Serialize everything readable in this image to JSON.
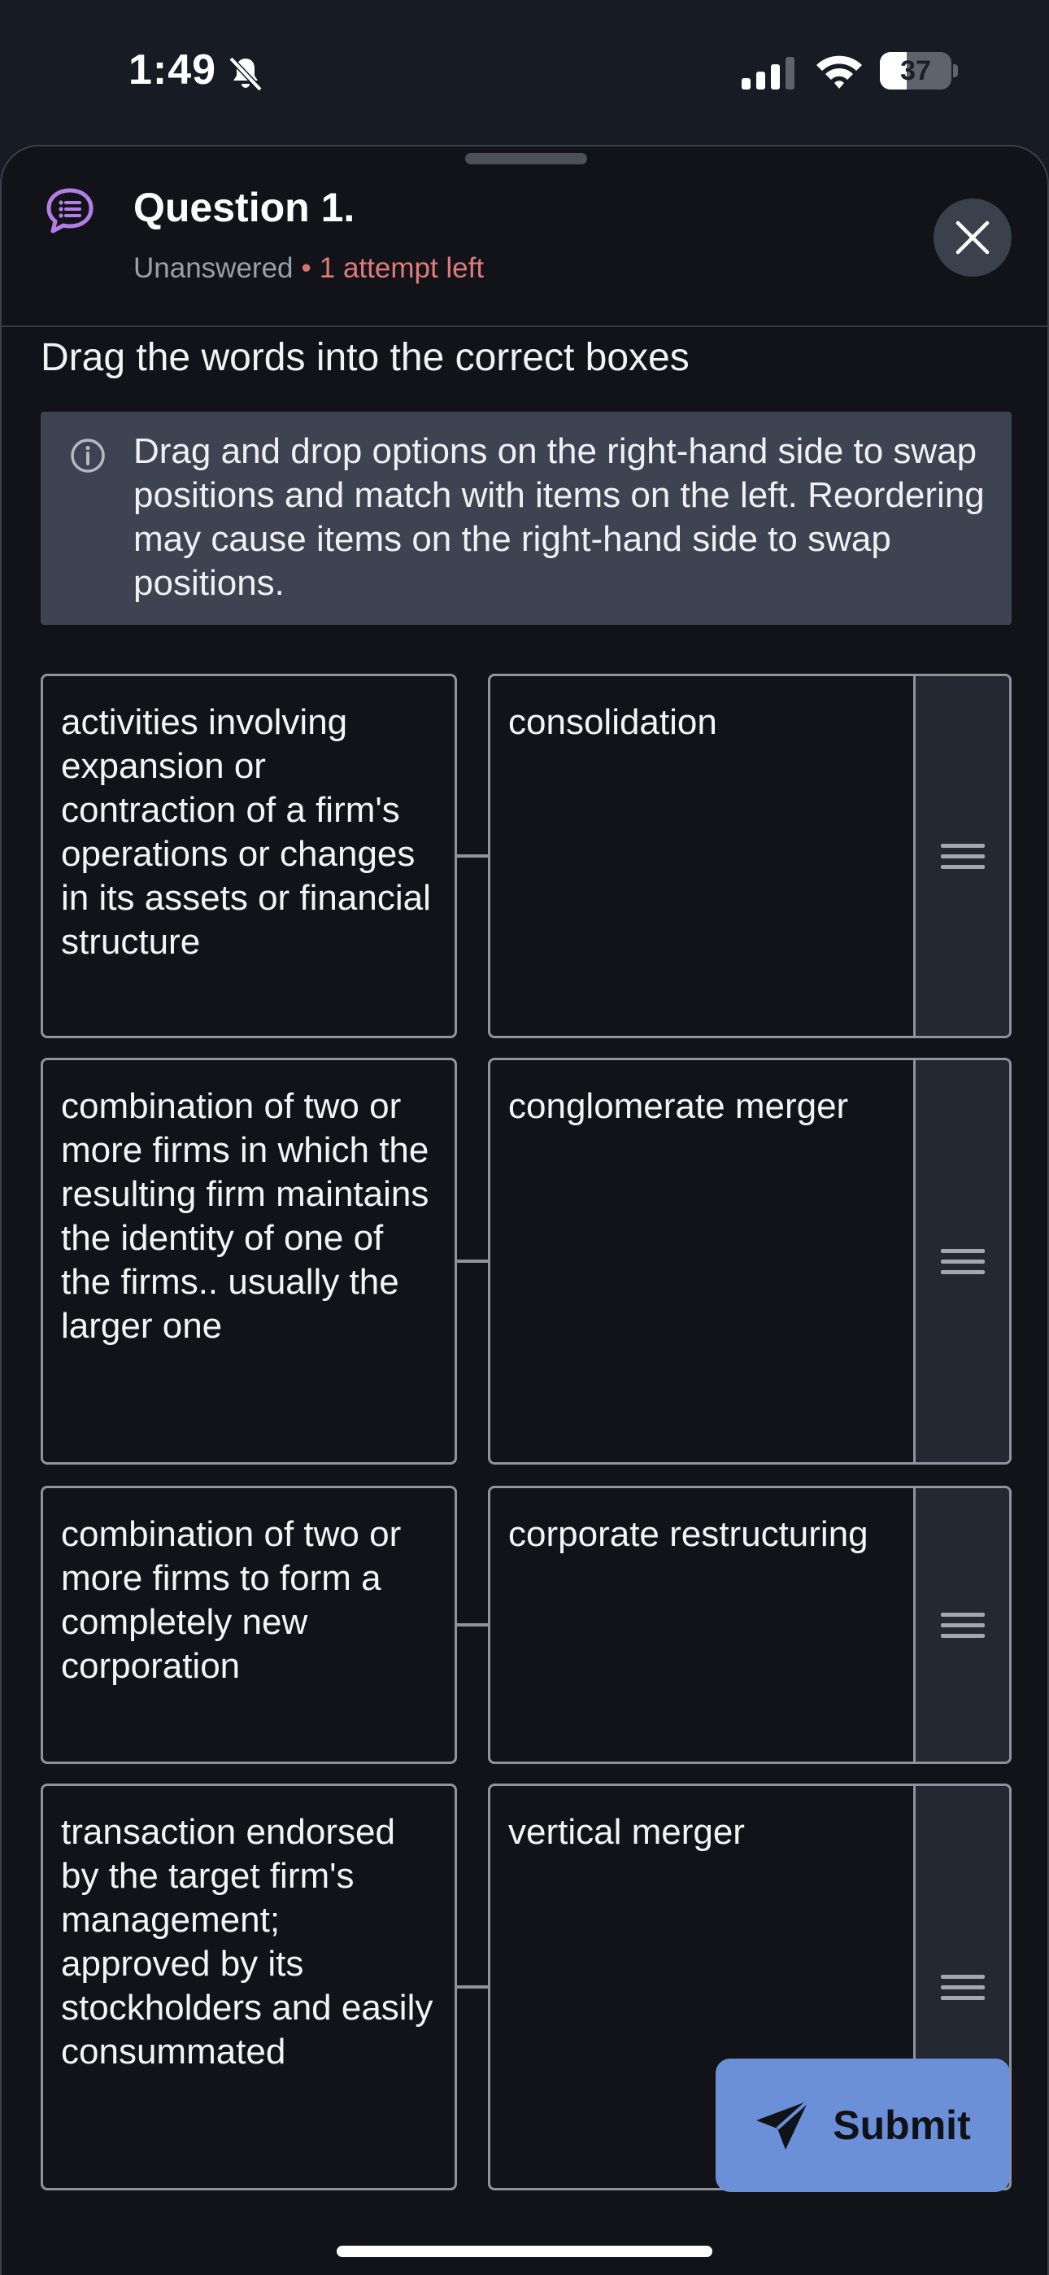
{
  "status_bar": {
    "time": "1:49",
    "battery_level": "37",
    "icons": [
      "bell-slash-icon",
      "cellular-signal-icon",
      "wifi-icon",
      "battery-icon"
    ]
  },
  "question": {
    "title": "Question 1.",
    "status": "Unanswered",
    "separator": "•",
    "attempts": "1 attempt left",
    "instruction": "Drag the words into the correct boxes",
    "info": "Drag and drop options on the right-hand side to swap positions and match with items on the left. Reordering may cause items on the right-hand side to swap positions."
  },
  "matches": [
    {
      "prompt": "activities involving expansion or contraction of a firm's operations or changes in its assets or financial structure",
      "answer": "consolidation"
    },
    {
      "prompt": "combination of two or more firms in which the resulting firm maintains the identity of one of the firms.. usually the larger one",
      "answer": "conglomerate merger"
    },
    {
      "prompt": "combination of two or more firms to form a completely new corporation",
      "answer": "corporate restructuring"
    },
    {
      "prompt": "transaction endorsed by the target firm's management; approved by its stockholders and easily consummated",
      "answer": "vertical merger"
    }
  ],
  "submit_label": "Submit",
  "colors": {
    "background": "#111319",
    "accent": "#6b90d8",
    "warning": "#e07b7b",
    "question_icon": "#b57ee6"
  }
}
